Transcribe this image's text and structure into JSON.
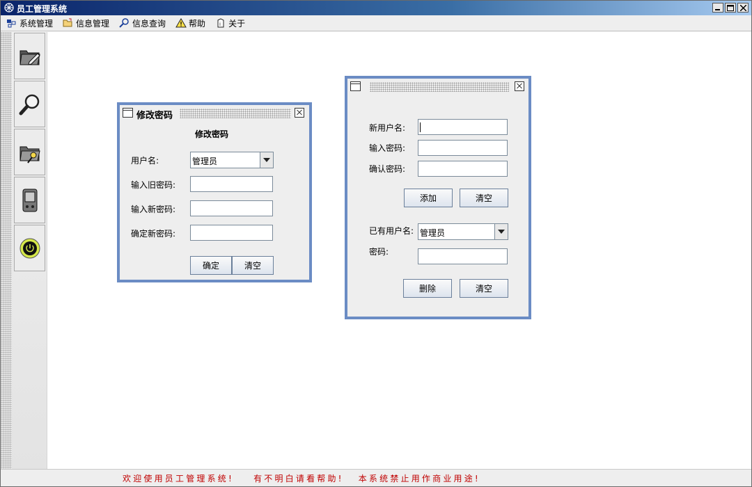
{
  "window": {
    "title": "员工管理系统",
    "controls": [
      "minimize",
      "maximize",
      "close"
    ]
  },
  "menu": {
    "items": [
      {
        "label": "系统管理",
        "icon": "system-icon"
      },
      {
        "label": "信息管理",
        "icon": "info-manage-icon"
      },
      {
        "label": "信息查询",
        "icon": "magnifier-icon"
      },
      {
        "label": "帮助",
        "icon": "warning-icon"
      },
      {
        "label": "关于",
        "icon": "about-icon"
      }
    ]
  },
  "toolbar": {
    "buttons": [
      {
        "icon": "folder-edit-icon"
      },
      {
        "icon": "magnifier-icon"
      },
      {
        "icon": "folder-key-icon"
      },
      {
        "icon": "pda-icon"
      },
      {
        "icon": "power-icon"
      }
    ]
  },
  "change_password": {
    "title": "修改密码",
    "heading": "修改密码",
    "username_label": "用户名:",
    "username_value": "管理员",
    "old_password_label": "输入旧密码:",
    "old_password_value": "",
    "new_password_label": "输入新密码:",
    "new_password_value": "",
    "confirm_password_label": "确定新密码:",
    "confirm_password_value": "",
    "confirm_button": "确定",
    "clear_button": "清空"
  },
  "user_manage": {
    "title": "",
    "new_username_label": "新用户名:",
    "new_username_value": "",
    "password_label": "输入密码:",
    "password_value": "",
    "confirm_label": "确认密码:",
    "confirm_value": "",
    "add_button": "添加",
    "clear_button_top": "清空",
    "existing_user_label": "已有用户名:",
    "existing_user_value": "管理员",
    "existing_password_label": "密码:",
    "existing_password_value": "",
    "delete_button": "删除",
    "clear_button_bottom": "清空"
  },
  "status": {
    "text": "欢迎使用员工管理系统!    有不明白请看帮助!   本系统禁止用作商业用途!"
  },
  "colors": {
    "title_gradient_start": "#0a246a",
    "title_gradient_end": "#a6caf0",
    "frame_border": "#6b8cc4",
    "status_text": "#c00000"
  }
}
